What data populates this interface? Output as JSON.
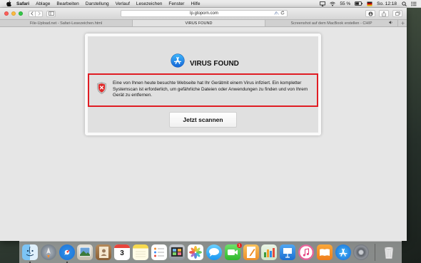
{
  "menubar": {
    "items": [
      "Safari",
      "Ablage",
      "Bearbeiten",
      "Darstellung",
      "Verlauf",
      "Lesezeichen",
      "Fenster",
      "Hilfe"
    ],
    "battery": "55 %",
    "clock": "So. 12:18"
  },
  "browser": {
    "url": "lp.gtoporn.com",
    "tabs": [
      {
        "label": "File-Upload.net - Safari-Lesezeichen.html"
      },
      {
        "label": "VIRUS FOUND"
      },
      {
        "label": "Screenshot auf dem MacBook erstellen - CHIP"
      }
    ]
  },
  "popup": {
    "title": "VIRUS FOUND",
    "message": "Eine von Ihnen heute besuchte Webseite hat Ihr Gerätmit einem Virus infiziert. Ein kompletter Systemscan ist erforderlich, um gefährliche Dateien oder Anwendungen zu finden und von Ihrem Gerät zu entfernen.",
    "button": "Jetzt scannen"
  },
  "dock": {
    "calendar_day": "3",
    "facetime_badge": "1",
    "apps": [
      "finder-icon",
      "launchpad-icon",
      "safari-icon",
      "preview-icon",
      "contacts-icon",
      "calendar-icon",
      "notes-icon",
      "reminders-icon",
      "photo-booth-icon",
      "photos-icon",
      "messages-icon",
      "facetime-icon",
      "pages-icon",
      "numbers-icon",
      "keynote-icon",
      "itunes-icon",
      "ibooks-icon",
      "app-store-icon",
      "system-preferences-icon",
      "trash-icon"
    ]
  },
  "colors": {
    "alert_border": "#e01d24",
    "accent_blue": "#1e8ff2"
  }
}
